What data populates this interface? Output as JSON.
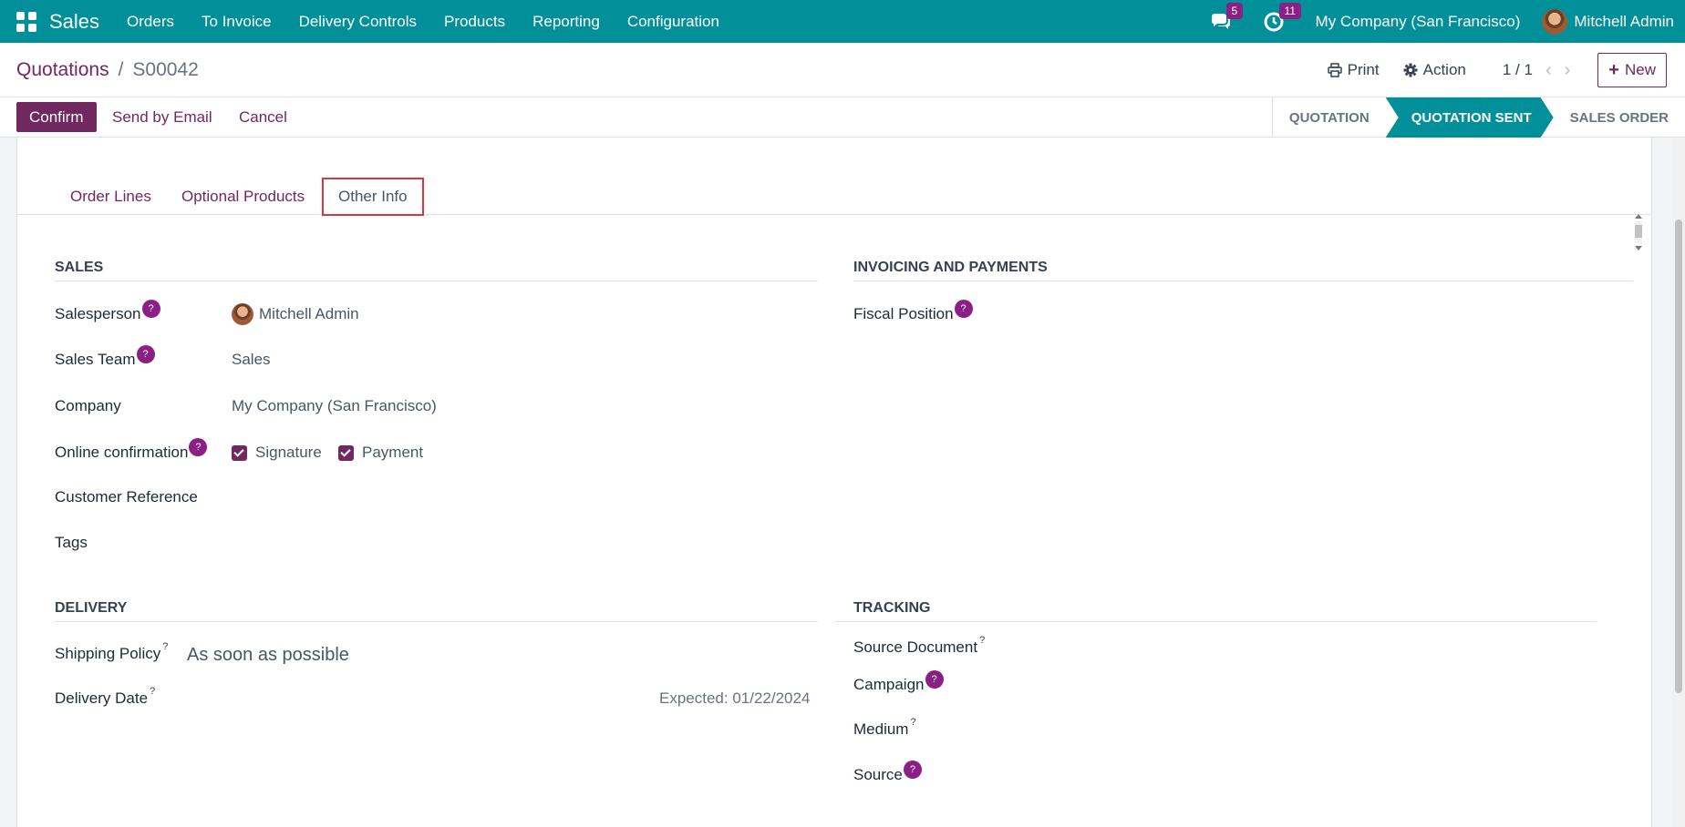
{
  "navbar": {
    "app_name": "Sales",
    "menu": [
      "Orders",
      "To Invoice",
      "Delivery Controls",
      "Products",
      "Reporting",
      "Configuration"
    ],
    "messages_count": "5",
    "activities_count": "11",
    "company": "My Company (San Francisco)",
    "user": "Mitchell Admin"
  },
  "breadcrumb": {
    "parent": "Quotations",
    "separator": "/",
    "current": "S00042"
  },
  "toolbar": {
    "print": "Print",
    "action": "Action",
    "pager": "1 / 1",
    "new": "New"
  },
  "actions": {
    "confirm": "Confirm",
    "send_email": "Send by Email",
    "cancel": "Cancel"
  },
  "status": {
    "steps": [
      "QUOTATION",
      "QUOTATION SENT",
      "SALES ORDER"
    ],
    "current": "QUOTATION SENT"
  },
  "tabs": [
    "Order Lines",
    "Optional Products",
    "Other Info"
  ],
  "active_tab": "Other Info",
  "sales": {
    "title": "SALES",
    "salesperson_label": "Salesperson",
    "salesperson": "Mitchell Admin",
    "team_label": "Sales Team",
    "team": "Sales",
    "company_label": "Company",
    "company": "My Company (San Francisco)",
    "online_label": "Online confirmation",
    "signature": "Signature",
    "payment": "Payment",
    "customer_ref_label": "Customer Reference",
    "tags_label": "Tags"
  },
  "invoicing": {
    "title": "INVOICING AND PAYMENTS",
    "fiscal_label": "Fiscal Position"
  },
  "delivery": {
    "title": "DELIVERY",
    "shipping_label": "Shipping Policy",
    "shipping_value": "As soon as possible",
    "date_label": "Delivery Date",
    "expected": "Expected: 01/22/2024"
  },
  "tracking": {
    "title": "TRACKING",
    "source_doc_label": "Source Document",
    "campaign_label": "Campaign",
    "medium_label": "Medium",
    "source_label": "Source"
  },
  "help_glyph": "?",
  "colors": {
    "navbar": "#01909a",
    "primary": "#71275f",
    "badge": "#8b1f85"
  }
}
